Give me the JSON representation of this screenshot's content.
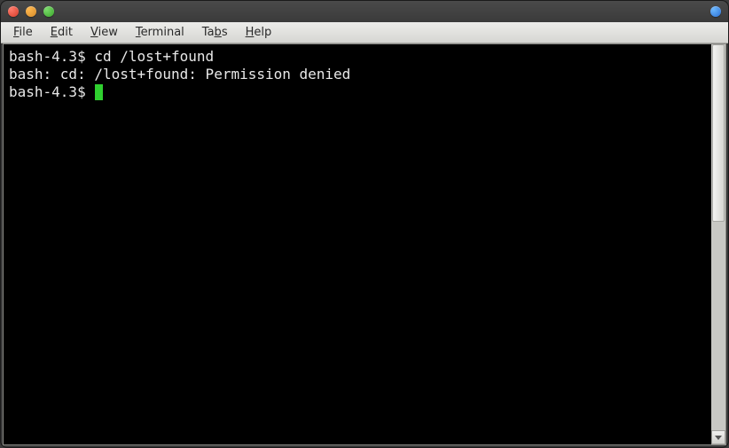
{
  "menubar": {
    "items": [
      {
        "prefix": "F",
        "rest": "ile"
      },
      {
        "prefix": "E",
        "rest": "dit"
      },
      {
        "prefix": "V",
        "rest": "iew"
      },
      {
        "prefix": "T",
        "rest": "erminal"
      },
      {
        "prefix": "",
        "rest": "Ta",
        "mid": "b",
        "tail": "s"
      },
      {
        "prefix": "H",
        "rest": "elp"
      }
    ]
  },
  "terminal": {
    "lines": [
      {
        "prompt": "bash-4.3$ ",
        "text": "cd /lost+found"
      },
      {
        "prompt": "",
        "text": "bash: cd: /lost+found: Permission denied"
      },
      {
        "prompt": "bash-4.3$ ",
        "text": "",
        "cursor": true
      }
    ]
  },
  "colors": {
    "cursor": "#2fd02f"
  }
}
